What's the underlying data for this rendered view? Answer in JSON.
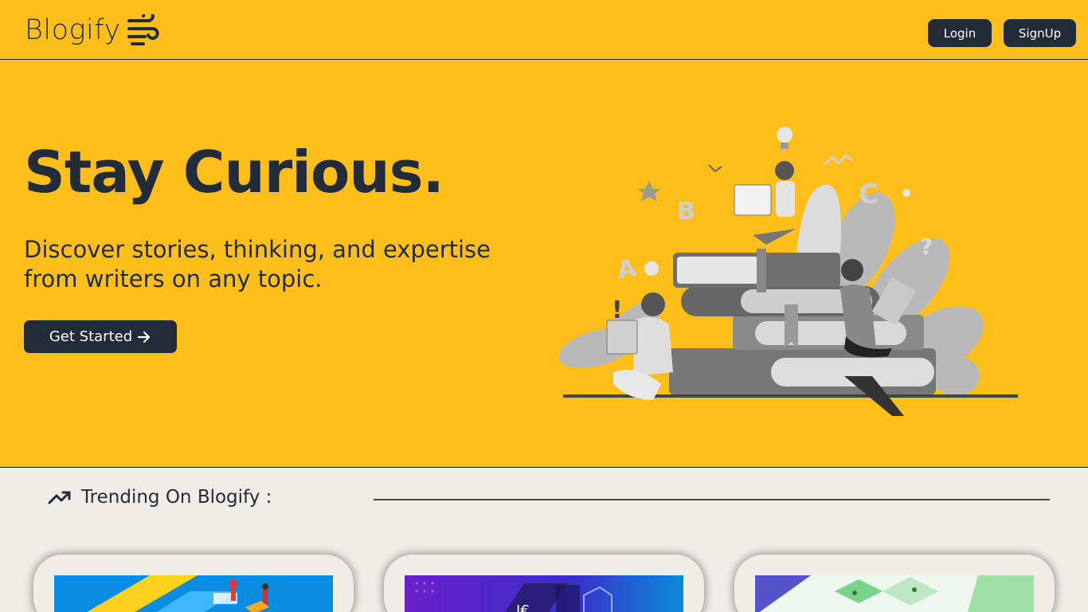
{
  "navbar": {
    "brand": "Blogify",
    "brand_icon": "wind-icon",
    "login_label": "Login",
    "signup_label": "SignUp",
    "background": "#ffbf1a",
    "accent": "#222b38"
  },
  "hero": {
    "title": "Stay Curious.",
    "subtitle": "Discover stories, thinking, and expertise from writers on any topic.",
    "cta_label": "Get Started",
    "cta_icon": "arrow-right-icon",
    "illustration": "people-reading-on-books-illustration"
  },
  "trending": {
    "icon": "trending-up-icon",
    "heading": "Trending On Blogify :",
    "cards": [
      {
        "image": "isometric-blue-yellow-illustration"
      },
      {
        "image": "purple-code-illustration"
      },
      {
        "image": "isometric-green-illustration"
      }
    ]
  }
}
